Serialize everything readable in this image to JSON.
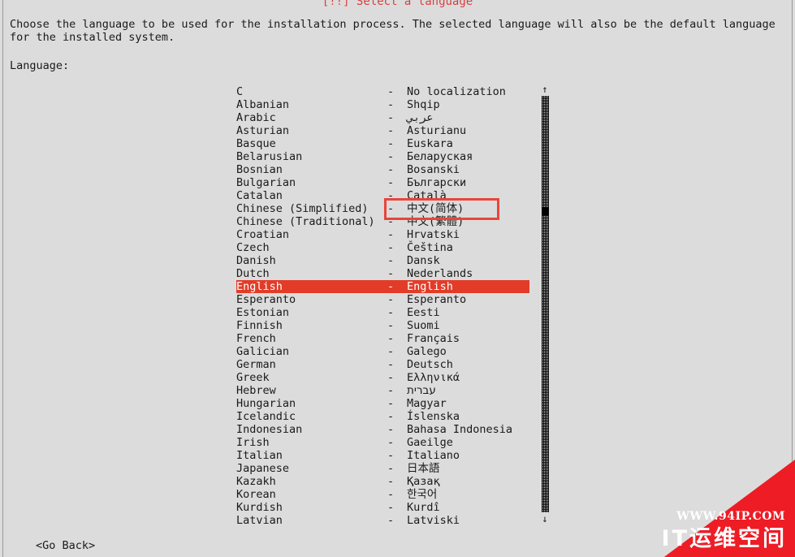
{
  "title": "[!!] Select a language",
  "description": "Choose the language to be used for the installation process. The selected language will also be the default language for the installed system.",
  "language_label": "Language:",
  "colors": {
    "background": "#dcdcdc",
    "title_red": "#d94040",
    "selection_red": "#e23c28",
    "annotation_red": "#e8453c",
    "watermark_red": "#ee1c25",
    "text": "#1a1a1a"
  },
  "separator": "-",
  "scrollbar": {
    "up_arrow": "↑",
    "down_arrow": "↓"
  },
  "languages": [
    {
      "english": "C",
      "native": "No localization",
      "selected": false
    },
    {
      "english": "Albanian",
      "native": "Shqip",
      "selected": false
    },
    {
      "english": "Arabic",
      "native": "عربي",
      "selected": false
    },
    {
      "english": "Asturian",
      "native": "Asturianu",
      "selected": false
    },
    {
      "english": "Basque",
      "native": "Euskara",
      "selected": false
    },
    {
      "english": "Belarusian",
      "native": "Беларуская",
      "selected": false
    },
    {
      "english": "Bosnian",
      "native": "Bosanski",
      "selected": false
    },
    {
      "english": "Bulgarian",
      "native": "Български",
      "selected": false
    },
    {
      "english": "Catalan",
      "native": "Català",
      "selected": false
    },
    {
      "english": "Chinese (Simplified)",
      "native": "中文(简体)",
      "selected": false,
      "annotated": true
    },
    {
      "english": "Chinese (Traditional)",
      "native": "中文(繁體)",
      "selected": false
    },
    {
      "english": "Croatian",
      "native": "Hrvatski",
      "selected": false
    },
    {
      "english": "Czech",
      "native": "Čeština",
      "selected": false
    },
    {
      "english": "Danish",
      "native": "Dansk",
      "selected": false
    },
    {
      "english": "Dutch",
      "native": "Nederlands",
      "selected": false
    },
    {
      "english": "English",
      "native": "English",
      "selected": true
    },
    {
      "english": "Esperanto",
      "native": "Esperanto",
      "selected": false
    },
    {
      "english": "Estonian",
      "native": "Eesti",
      "selected": false
    },
    {
      "english": "Finnish",
      "native": "Suomi",
      "selected": false
    },
    {
      "english": "French",
      "native": "Français",
      "selected": false
    },
    {
      "english": "Galician",
      "native": "Galego",
      "selected": false
    },
    {
      "english": "German",
      "native": "Deutsch",
      "selected": false
    },
    {
      "english": "Greek",
      "native": "Ελληνικά",
      "selected": false
    },
    {
      "english": "Hebrew",
      "native": "עברית",
      "selected": false
    },
    {
      "english": "Hungarian",
      "native": "Magyar",
      "selected": false
    },
    {
      "english": "Icelandic",
      "native": "Íslenska",
      "selected": false
    },
    {
      "english": "Indonesian",
      "native": "Bahasa Indonesia",
      "selected": false
    },
    {
      "english": "Irish",
      "native": "Gaeilge",
      "selected": false
    },
    {
      "english": "Italian",
      "native": "Italiano",
      "selected": false
    },
    {
      "english": "Japanese",
      "native": "日本語",
      "selected": false
    },
    {
      "english": "Kazakh",
      "native": "Қазақ",
      "selected": false
    },
    {
      "english": "Korean",
      "native": "한국어",
      "selected": false
    },
    {
      "english": "Kurdish",
      "native": "Kurdî",
      "selected": false
    },
    {
      "english": "Latvian",
      "native": "Latviski",
      "selected": false
    }
  ],
  "buttons": {
    "go_back": "<Go Back>"
  },
  "watermark": {
    "url": "WWW.94IP.COM",
    "name": "IT运维空间"
  }
}
